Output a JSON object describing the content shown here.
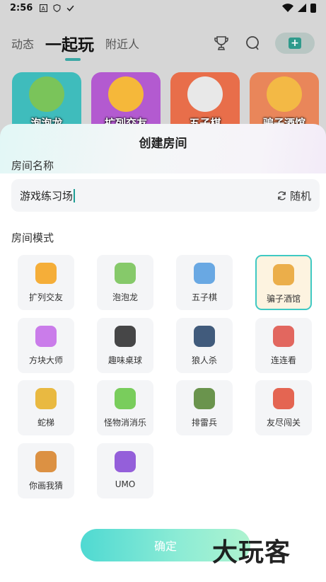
{
  "status_bar": {
    "time": "2:56"
  },
  "top_nav": {
    "tabs": [
      {
        "label": "动态"
      },
      {
        "label": "一起玩"
      },
      {
        "label": "附近人"
      }
    ],
    "home_button_glyph": "+"
  },
  "cards": [
    {
      "label": "泡泡龙",
      "color": "#3fbcbc"
    },
    {
      "label": "扩列交友",
      "color": "#b35ad0"
    },
    {
      "label": "五子棋",
      "color": "#e86e4a"
    },
    {
      "label": "骗子酒馆",
      "color": "#e9865a"
    }
  ],
  "sheet": {
    "title": "创建房间",
    "name_label": "房间名称",
    "name_value": "游戏练习场",
    "random_label": "随机",
    "mode_label": "房间模式",
    "modes": [
      {
        "label": "扩列交友",
        "icon": "heart-face-icon",
        "color": "#f5a623",
        "selected": false
      },
      {
        "label": "泡泡龙",
        "icon": "dragon-icon",
        "color": "#7ac45a",
        "selected": false
      },
      {
        "label": "五子棋",
        "icon": "go-board-icon",
        "color": "#5aa0e0",
        "selected": false
      },
      {
        "label": "骗子酒馆",
        "icon": "beer-mug-icon",
        "color": "#e9a63a",
        "selected": true
      },
      {
        "label": "方块大师",
        "icon": "cube-icon",
        "color": "#c56fe8",
        "selected": false
      },
      {
        "label": "趣味桌球",
        "icon": "billiard-ball-icon",
        "color": "#333333",
        "selected": false
      },
      {
        "label": "狼人杀",
        "icon": "wolf-icon",
        "color": "#2d4a6e",
        "selected": false
      },
      {
        "label": "连连看",
        "icon": "tiles-icon",
        "color": "#e0584e",
        "selected": false
      },
      {
        "label": "蛇梯",
        "icon": "snake-icon",
        "color": "#e8b32c",
        "selected": false
      },
      {
        "label": "怪物消消乐",
        "icon": "monster-icon",
        "color": "#6cc94a",
        "selected": false
      },
      {
        "label": "排雷兵",
        "icon": "soldier-icon",
        "color": "#5b8a3a",
        "selected": false
      },
      {
        "label": "友尽闯关",
        "icon": "flag-icon",
        "color": "#e2553f",
        "selected": false
      },
      {
        "label": "你画我猜",
        "icon": "palette-icon",
        "color": "#d9862f",
        "selected": false
      },
      {
        "label": "UMO",
        "icon": "uno-cards-icon",
        "color": "#8a4fd6",
        "selected": false
      }
    ],
    "confirm_label": "确定"
  },
  "watermark": "大玩客"
}
